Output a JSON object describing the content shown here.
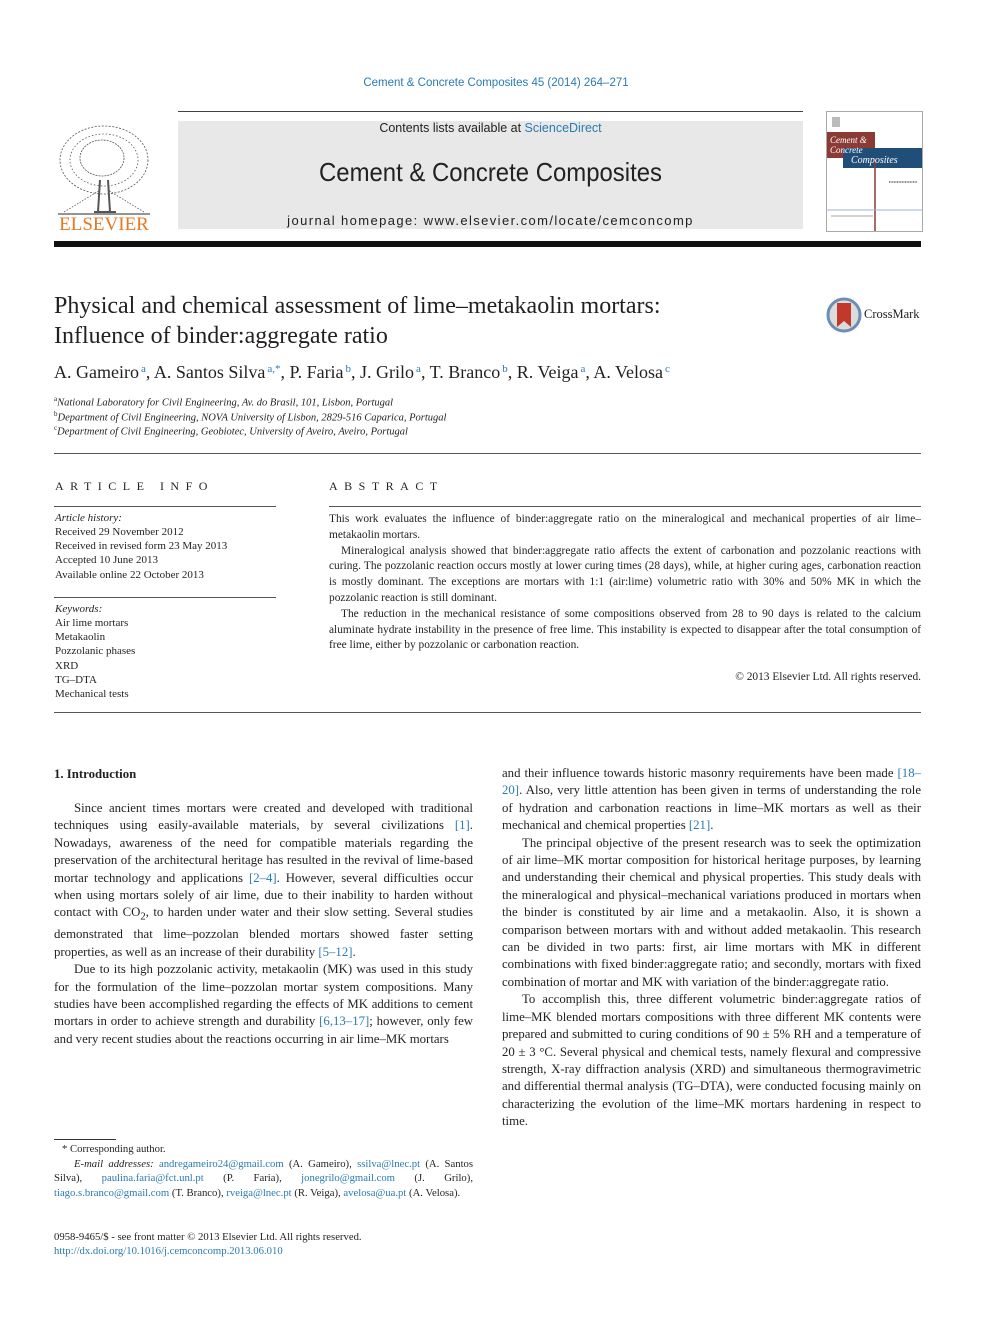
{
  "header": {
    "journal_reference": "Cement & Concrete Composites 45 (2014) 264–271",
    "contents_prefix": "Contents lists available at ",
    "contents_link": "ScienceDirect",
    "journal_name": "Cement & Concrete Composites",
    "homepage": "journal homepage: www.elsevier.com/locate/cemconcomp",
    "publisher_logo_text": "ELSEVIER",
    "cover": {
      "title_line1": "Cement &",
      "title_line2": "Concrete",
      "title_line3": "Composites",
      "colors": {
        "red": "#8b3a34",
        "blue": "#1f4e79"
      }
    },
    "crossmark_label": "CrossMark"
  },
  "article": {
    "title_line1": "Physical and chemical assessment of lime–metakaolin mortars:",
    "title_line2": "Influence of binder:aggregate ratio",
    "authors": [
      {
        "name": "A. Gameiro",
        "sup": "a"
      },
      {
        "name": "A. Santos Silva",
        "sup": "a,*"
      },
      {
        "name": "P. Faria",
        "sup": "b"
      },
      {
        "name": "J. Grilo",
        "sup": "a"
      },
      {
        "name": "T. Branco",
        "sup": "b"
      },
      {
        "name": "R. Veiga",
        "sup": "a"
      },
      {
        "name": "A. Velosa",
        "sup": "c"
      }
    ],
    "affiliations": [
      {
        "sup": "a",
        "text": "National Laboratory for Civil Engineering, Av. do Brasil, 101, Lisbon, Portugal"
      },
      {
        "sup": "b",
        "text": "Department of Civil Engineering, NOVA University of Lisbon, 2829-516 Caparica, Portugal"
      },
      {
        "sup": "c",
        "text": "Department of Civil Engineering, Geobiotec, University of Aveiro, Aveiro, Portugal"
      }
    ]
  },
  "article_info": {
    "heading": "ARTICLE INFO",
    "history_label": "Article history:",
    "history": [
      "Received 29 November 2012",
      "Received in revised form 23 May 2013",
      "Accepted 10 June 2013",
      "Available online 22 October 2013"
    ],
    "keywords_label": "Keywords:",
    "keywords": [
      "Air lime mortars",
      "Metakaolin",
      "Pozzolanic phases",
      "XRD",
      "TG–DTA",
      "Mechanical tests"
    ]
  },
  "abstract": {
    "heading": "ABSTRACT",
    "paragraphs": [
      "This work evaluates the influence of binder:aggregate ratio on the mineralogical and mechanical properties of air lime–metakaolin mortars.",
      "Mineralogical analysis showed that binder:aggregate ratio affects the extent of carbonation and pozzolanic reactions with curing. The pozzolanic reaction occurs mostly at lower curing times (28 days), while, at higher curing ages, carbonation reaction is mostly dominant. The exceptions are mortars with 1:1 (air:lime) volumetric ratio with 30% and 50% MK in which the pozzolanic reaction is still dominant.",
      "The reduction in the mechanical resistance of some compositions observed from 28 to 90 days is related to the calcium aluminate hydrate instability in the presence of free lime. This instability is expected to disappear after the total consumption of free lime, either by pozzolanic or carbonation reaction."
    ],
    "copyright": "© 2013 Elsevier Ltd. All rights reserved."
  },
  "body": {
    "section_heading": "1. Introduction",
    "left": {
      "p1": [
        {
          "t": "Since ancient times mortars were created and developed with traditional techniques using easily-available materials, by several civilizations "
        },
        {
          "c": "[1]"
        },
        {
          "t": ". Nowadays, awareness of the need for compatible materials regarding the preservation of the architectural heritage has resulted in the revival of lime-based mortar technology and applications "
        },
        {
          "c": "[2–4]"
        },
        {
          "t": ". However, several difficulties occur when using mortars solely of air lime, due to their inability to harden without contact with CO"
        },
        {
          "sub": "2"
        },
        {
          "t": ", to harden under water and their slow setting. Several studies demonstrated that lime–pozzolan blended mortars showed faster setting properties, as well as an increase of their durability "
        },
        {
          "c": "[5–12]"
        },
        {
          "t": "."
        }
      ],
      "p2": [
        {
          "t": "Due to its high pozzolanic activity, metakaolin (MK) was used in this study for the formulation of the lime–pozzolan mortar system compositions. Many studies have been accomplished regarding the effects of MK additions to cement mortars in order to achieve strength and durability "
        },
        {
          "c": "[6,13–17]"
        },
        {
          "t": "; however, only few and very recent studies about the reactions occurring in air lime–MK mortars"
        }
      ]
    },
    "right": {
      "p1": [
        {
          "t": "and their influence towards historic masonry requirements have been made "
        },
        {
          "c": "[18–20]"
        },
        {
          "t": ". Also, very little attention has been given in terms of understanding the role of hydration and carbonation reactions in lime–MK mortars as well as their mechanical and chemical properties "
        },
        {
          "c": "[21]"
        },
        {
          "t": "."
        }
      ],
      "p2": [
        {
          "t": "The principal objective of the present research was to seek the optimization of air lime–MK mortar composition for historical heritage purposes, by learning and understanding their chemical and physical properties. This study deals with the mineralogical and physical–mechanical variations produced in mortars when the binder is constituted by air lime and a metakaolin. Also, it is shown a comparison between mortars with and without added metakaolin. This research can be divided in two parts: first, air lime mortars with MK in different combinations with fixed binder:aggregate ratio; and secondly, mortars with fixed combination of mortar and MK with variation of the binder:aggregate ratio."
        }
      ],
      "p3": [
        {
          "t": "To accomplish this, three different volumetric binder:aggregate ratios of lime–MK blended mortars compositions with three different MK contents were prepared and submitted to curing conditions of 90 ± 5% RH and a temperature of 20 ± 3 °C. Several physical and chemical tests, namely flexural and compressive strength, X-ray diffraction analysis (XRD) and simultaneous thermogravimetric and differential thermal analysis (TG–DTA), were conducted focusing mainly on characterizing the evolution of the lime–MK mortars hardening in respect to time."
        }
      ]
    }
  },
  "footnotes": {
    "corresponding": "* Corresponding author.",
    "email_label": "E-mail addresses:",
    "emails": [
      {
        "email": "andregameiro24@gmail.com",
        "name": "(A. Gameiro),"
      },
      {
        "email": "ssilva@lnec.pt",
        "name": "(A. Santos Silva),"
      },
      {
        "email": "paulina.faria@fct.unl.pt",
        "name": "(P. Faria),"
      },
      {
        "email": "jonegrilo@gmail.com",
        "name": "(J. Grilo),"
      },
      {
        "email": "tiago.s.branco@gmail.com",
        "name": "(T. Branco),"
      },
      {
        "email": "rveiga@lnec.pt",
        "name": "(R. Veiga),"
      },
      {
        "email": "avelosa@ua.pt",
        "name": "(A. Velosa)."
      }
    ],
    "front_matter": "0958-9465/$ - see front matter © 2013 Elsevier Ltd. All rights reserved.",
    "doi": "http://dx.doi.org/10.1016/j.cemconcomp.2013.06.010"
  }
}
